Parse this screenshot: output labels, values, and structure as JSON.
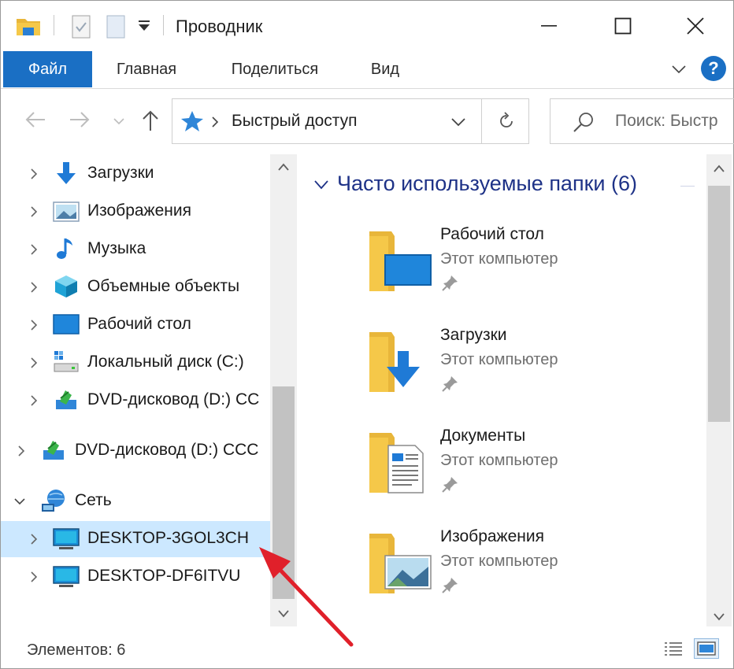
{
  "window": {
    "title": "Проводник",
    "quick_access_toolbar": [
      "folder-icon",
      "properties-icon",
      "new-folder-icon",
      "customize-dropdown-icon"
    ],
    "controls": [
      "minimize",
      "maximize",
      "close"
    ]
  },
  "ribbon": {
    "tabs": [
      {
        "label": "Файл",
        "active": true
      },
      {
        "label": "Главная"
      },
      {
        "label": "Поделиться"
      },
      {
        "label": "Вид"
      }
    ],
    "help_label": "?"
  },
  "navigation": {
    "address": {
      "path_label": "Быстрый доступ",
      "icon": "quick-access-star-icon"
    },
    "search": {
      "placeholder": "Поиск: Быстр"
    }
  },
  "nav_pane": {
    "items": [
      {
        "label": "Загрузки",
        "icon": "downloads-icon",
        "expanded": false
      },
      {
        "label": "Изображения",
        "icon": "pictures-icon",
        "expanded": false
      },
      {
        "label": "Музыка",
        "icon": "music-icon",
        "expanded": false
      },
      {
        "label": "Объемные объекты",
        "icon": "3d-objects-icon",
        "expanded": false
      },
      {
        "label": "Рабочий стол",
        "icon": "desktop-icon",
        "expanded": false
      },
      {
        "label": "Локальный диск (C:)",
        "icon": "local-disk-icon",
        "expanded": false
      },
      {
        "label": "DVD-дисковод (D:) CC",
        "icon": "dvd-drive-icon",
        "expanded": false
      },
      {
        "label": "DVD-дисковод (D:) CCC",
        "icon": "dvd-drive-icon",
        "expanded": false
      },
      {
        "label": "Сеть",
        "icon": "network-icon",
        "expanded": true
      },
      {
        "label": "DESKTOP-3GOL3CH",
        "icon": "computer-icon",
        "expanded": false,
        "selected": true
      },
      {
        "label": "DESKTOP-DF6ITVU",
        "icon": "computer-icon",
        "expanded": false
      }
    ]
  },
  "content": {
    "group_header": "Часто используемые папки (6)",
    "tiles": [
      {
        "title": "Рабочий стол",
        "location": "Этот компьютер",
        "icon": "desktop-folder-icon"
      },
      {
        "title": "Загрузки",
        "location": "Этот компьютер",
        "icon": "downloads-folder-icon"
      },
      {
        "title": "Документы",
        "location": "Этот компьютер",
        "icon": "documents-folder-icon"
      },
      {
        "title": "Изображения",
        "location": "Этот компьютер",
        "icon": "pictures-folder-icon"
      }
    ]
  },
  "status_bar": {
    "items_count": "Элементов: 6"
  },
  "colors": {
    "accent": "#1a6fc4",
    "selection": "#cce8ff",
    "group_header": "#1e3287",
    "annotation_arrow": "#e0202a",
    "folder": "#f5c849"
  }
}
